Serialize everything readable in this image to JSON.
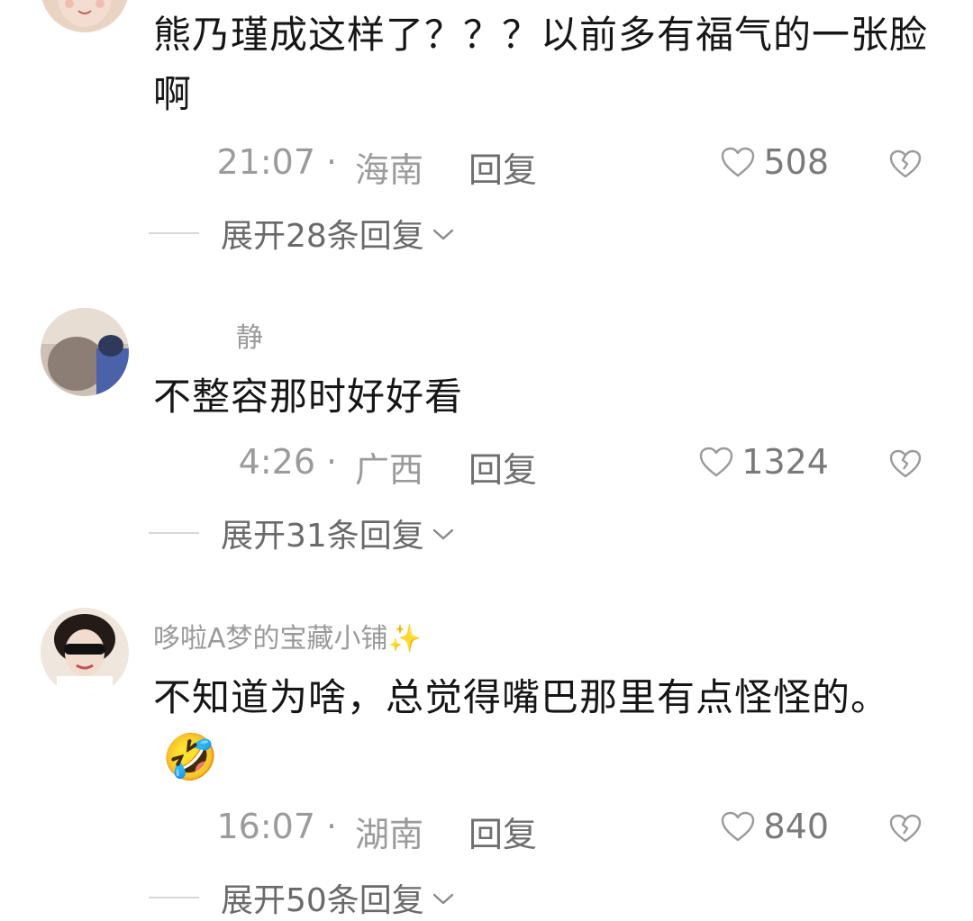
{
  "comments": [
    {
      "username": "",
      "text": "熊乃瑾成这样了？？？以前多有福气的一张脸啊",
      "time": "21:07",
      "separator": "·",
      "region": "海南",
      "reply_label": "回复",
      "likes": "508",
      "expand_label": "展开28条回复"
    },
    {
      "username": "静",
      "text": "不整容那时好好看",
      "time": "4:26",
      "separator": "·",
      "region": "广西",
      "reply_label": "回复",
      "likes": "1324",
      "expand_label": "展开31条回复"
    },
    {
      "username": "哆啦A梦的宝藏小铺✨",
      "text": "不知道为啥，总觉得嘴巴那里有点怪怪的。",
      "emoji": "🤣",
      "time": "16:07",
      "separator": "·",
      "region": "湖南",
      "reply_label": "回复",
      "likes": "840",
      "expand_label": "展开50条回复"
    }
  ],
  "icons": {
    "like": "heart-outline-icon",
    "dislike": "broken-heart-icon",
    "expand": "chevron-down-icon"
  },
  "colors": {
    "primary_text": "#161616",
    "secondary_text": "#9b9b9b",
    "background": "#ffffff"
  }
}
